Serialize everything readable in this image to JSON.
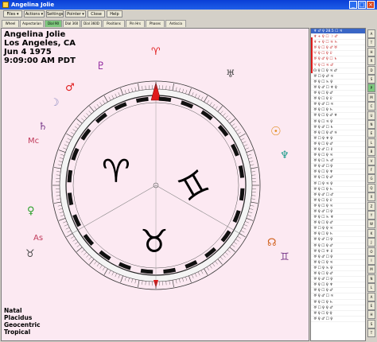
{
  "window": {
    "title": "Angelina Jolie"
  },
  "menu": {
    "files": "Files ▾",
    "actions": "Actions ▾",
    "settings": "Settings",
    "pointer": "Pointer ▾",
    "close": "Close",
    "help": "Help"
  },
  "tabs": [
    "Wheel",
    "Aspectarian",
    "Dial 90",
    "Dial 360",
    "Dial 360D",
    "Positions",
    "Pin Hrs",
    "Phases",
    "Antiscia"
  ],
  "active_tab": "Dial 90",
  "chart": {
    "name": "Angelina Jolie",
    "place": "Los Angeles, CA",
    "date": "Jun 4 1975",
    "time": "9:09:00 AM PDT",
    "type": "Natal",
    "house_system": "Placidus",
    "coordinates": "Geocentric",
    "zodiac": "Tropical",
    "sign_glyphs": [
      "♈",
      "♊",
      "♉"
    ],
    "planets": [
      {
        "name": "Aries point",
        "glyph": "♈",
        "color": "#e01a1a"
      },
      {
        "name": "Pluto",
        "glyph": "♇",
        "color": "#8a1a9a"
      },
      {
        "name": "Uranus",
        "glyph": "♅",
        "color": "#4a4a4a"
      },
      {
        "name": "Mars",
        "glyph": "♂",
        "color": "#e01a1a"
      },
      {
        "name": "Moon",
        "glyph": "☽",
        "color": "#8a8ac0"
      },
      {
        "name": "Saturn",
        "glyph": "♄",
        "color": "#7a3a8a"
      },
      {
        "name": "Midheaven",
        "glyph": "Mc",
        "color": "#c03a5a"
      },
      {
        "name": "Sun",
        "glyph": "☉",
        "color": "#e08a1a"
      },
      {
        "name": "Neptune",
        "glyph": "♆",
        "color": "#1a9a8a"
      },
      {
        "name": "Venus",
        "glyph": "♀",
        "color": "#2aa02a"
      },
      {
        "name": "Ascendant",
        "glyph": "As",
        "color": "#c03a5a"
      },
      {
        "name": "Taurus",
        "glyph": "♉",
        "color": "#4a4a4a"
      },
      {
        "name": "Node",
        "glyph": "☊",
        "color": "#d0601a"
      },
      {
        "name": "Gemini",
        "glyph": "♊",
        "color": "#7a3a8a"
      }
    ]
  },
  "aspect_list": [
    "♆ ♂ ♀ 28.5 ☐ ♃",
    "♆ + ♀ ☐ ☽ ♂",
    "♆ + ♀ ☐ ♃ ♄",
    "♅ ♀ ☐ ♀ ♂ ♅",
    "♈ ♀ ☐ ♀ ♇",
    "♅ ♀ ♂ ♀ ☐ ♄",
    "♈ ♀ ☐ ♃ ♂",
    "☊ ♀ ☐ ♀ ♃ ♂",
    "♅ ☐ ♀ ♂ ♃",
    "♅ ♀ ☐ ♄ ♀",
    "♅ ♀ ♂ ☐ ♆ ♀",
    "♅ ♀ ☐ ♀ ♂",
    "♅ ♀ ☐ ♀ ♇",
    "♅ ♀ ♂ ☐ ♃",
    "♅ ♀ ☐ ♀ ♄",
    "♅ ♀ ☐ ♀ ♂ ♆",
    "♅ ♀ ☐ ♃ ♀",
    "♅ ♀ ♂ ☐ ♄",
    "♅ ♀ ☐ ♀ ♂ ♃",
    "♅ ☐ ♀ ♆ ♀",
    "♅ ♀ ☐ ♀ ♂",
    "♅ ♀ ♂ ☐ ♇",
    "♅ ♀ ☐ ♀ ♃",
    "♅ ♀ ☐ ♄ ♂",
    "♅ ♀ ♂ ☐ ♀",
    "♅ ♀ ☐ ♀ ♆",
    "♅ ♀ ☐ ♀ ♂",
    "♅ ☐ ♀ ♃ ♀",
    "♅ ♀ ☐ ♀ ♄",
    "♅ ♀ ♂ ☐ ♂",
    "♅ ♀ ☐ ♀ ♇",
    "♅ ♀ ☐ ♀ ♃",
    "♅ ♀ ♂ ☐ ♀",
    "♅ ♀ ☐ ♄ ♆",
    "♅ ♀ ☐ ♀ ♂",
    "♅ ☐ ♀ ♀ ♃",
    "♅ ♀ ☐ ♀ ♄",
    "♅ ♀ ♂ ☐ ♀",
    "♅ ♀ ☐ ♀ ♂",
    "♅ ♀ ☐ ♆ ♇",
    "♅ ♀ ♂ ☐ ♀",
    "♅ ♀ ☐ ♀ ♃",
    "♅ ☐ ♀ ♄ ♀",
    "♅ ♀ ☐ ♀ ♂",
    "♅ ♀ ♂ ☐ ♀",
    "♅ ♀ ☐ ♀ ♆",
    "♅ ♀ ☐ ♀ ♂",
    "♅ ♀ ♂ ☐ ♃",
    "♅ ♀ ☐ ♀ ♄",
    "♅ ☐ ♀ ♀ ♂",
    "♅ ♀ ☐ ♀ ♀",
    "♅ ♀ ♂ ☐ ♀"
  ],
  "side_tabs": [
    "A",
    "T",
    "H",
    "R",
    "D",
    "S",
    "P",
    "M",
    "C",
    "U",
    "N",
    "E",
    "L",
    "B",
    "V",
    "F",
    "G",
    "Q",
    "X",
    "Z",
    "Y",
    "W",
    "K",
    "J",
    "O",
    "I",
    "M",
    "N",
    "L",
    "A",
    "E",
    "H",
    "S",
    "T"
  ],
  "colors": {
    "chart_bg": "#fce9f2",
    "selected_row": "#3a66c6",
    "active_tab": "#7dc77d",
    "titlebar": "#0a3fd6"
  }
}
